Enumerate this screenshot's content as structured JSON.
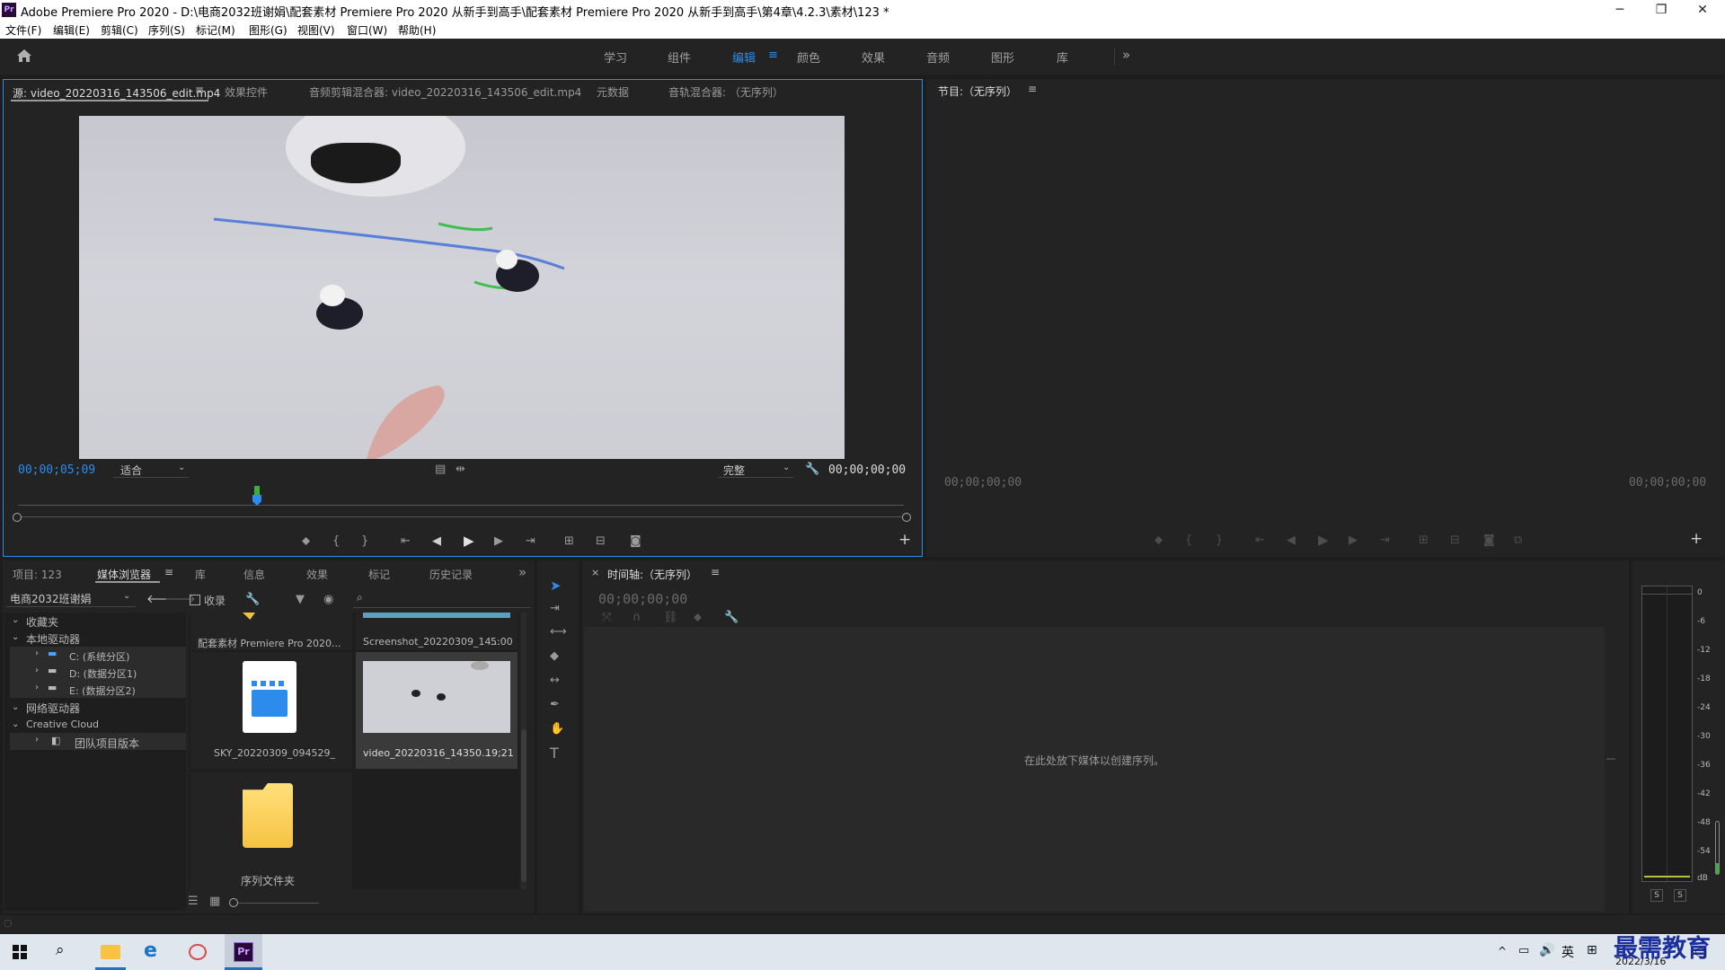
{
  "window": {
    "title": "Adobe Premiere Pro 2020 - D:\\电商2032班谢娟\\配套素材 Premiere Pro 2020 从新手到高手\\配套素材 Premiere Pro 2020 从新手到高手\\第4章\\4.2.3\\素材\\123 *",
    "app_badge": "Pr",
    "minimize": "─",
    "maximize": "❐",
    "close": "✕"
  },
  "menu": [
    "文件(F)",
    "编辑(E)",
    "剪辑(C)",
    "序列(S)",
    "标记(M)",
    "图形(G)",
    "视图(V)",
    "窗口(W)",
    "帮助(H)"
  ],
  "workspaces": {
    "items": [
      "学习",
      "组件",
      "编辑",
      "颜色",
      "效果",
      "音频",
      "图形",
      "库"
    ],
    "active": "编辑",
    "more": "»"
  },
  "source_monitor": {
    "tabs": [
      "源: video_20220316_143506_edit.mp4",
      "效果控件",
      "音频剪辑混合器: video_20220316_143506_edit.mp4",
      "元数据",
      "音轨混合器: （无序列）"
    ],
    "timecode": "00;00;05;09",
    "fit": "适合",
    "quality": "完整",
    "duration": "00;00;00;00",
    "add": "+"
  },
  "program_monitor": {
    "title": "节目:（无序列）",
    "tc_left": "00;00;00;00",
    "tc_right": "00;00;00;00",
    "add": "+"
  },
  "project_panel": {
    "tabs": [
      "项目: 123",
      "媒体浏览器",
      "库",
      "信息",
      "效果",
      "标记",
      "历史记录"
    ],
    "active_tab": "媒体浏览器",
    "location": "电商2032班谢娟",
    "ingest_label": "收录",
    "tree": {
      "favorites": "收藏夹",
      "local": "本地驱动器",
      "drives": [
        "C: (系统分区)",
        "D: (数据分区1)",
        "E: (数据分区2)"
      ],
      "network": "网络驱动器",
      "cloud": "Creative Cloud",
      "team": "团队项目版本"
    },
    "files": [
      {
        "name": "配套素材 Premiere Pro 2020...",
        "duration": ""
      },
      {
        "name": "Screenshot_20220309_14...",
        "duration": "5:00"
      },
      {
        "name": "SKY_20220309_094529_",
        "duration": ""
      },
      {
        "name": "video_20220316_14350...",
        "duration": "19;21"
      },
      {
        "name": "序列文件夹",
        "duration": ""
      }
    ]
  },
  "timeline": {
    "title": "时间轴:（无序列）",
    "timecode": "00;00;00;00",
    "drop_hint": "在此处放下媒体以创建序列。"
  },
  "audio_meter": {
    "scale": [
      "0",
      "-6",
      "-12",
      "-18",
      "-24",
      "-30",
      "-36",
      "-42",
      "-48",
      "-54",
      "dB"
    ],
    "solo": [
      "S",
      "S"
    ]
  },
  "taskbar": {
    "ime": "英",
    "date": "2022/3/16",
    "watermark": "最需教育"
  }
}
